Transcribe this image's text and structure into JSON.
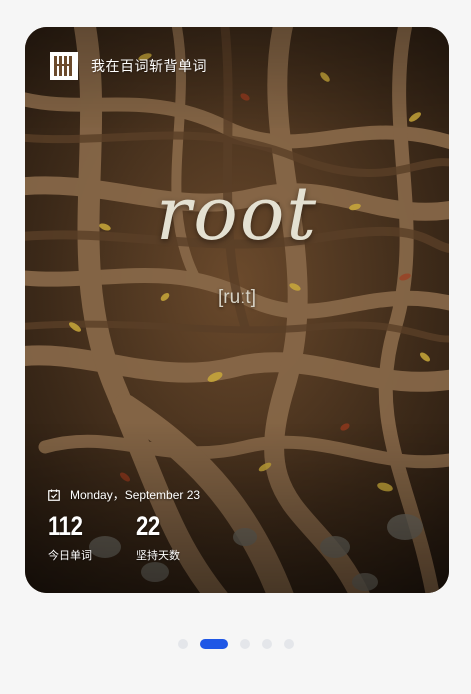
{
  "app": {
    "brand_text": "我在百词斩背单词"
  },
  "word_card": {
    "word": "root",
    "phonetic": "[ruːt]",
    "date": "Monday，September 23",
    "stats": [
      {
        "value": "112",
        "label": "今日单词"
      },
      {
        "value": "22",
        "label": "坚持天数"
      }
    ]
  },
  "pagination": {
    "total_pages": 5,
    "active_index": 1
  },
  "colors": {
    "accent": "#1f57e6",
    "inactive_dot": "#e4e6ea",
    "word_text": "#e4e1d2",
    "background": "#f6f6f6"
  },
  "icons": {
    "logo": "baicizhan-logo-icon",
    "calendar": "calendar-check-icon"
  }
}
